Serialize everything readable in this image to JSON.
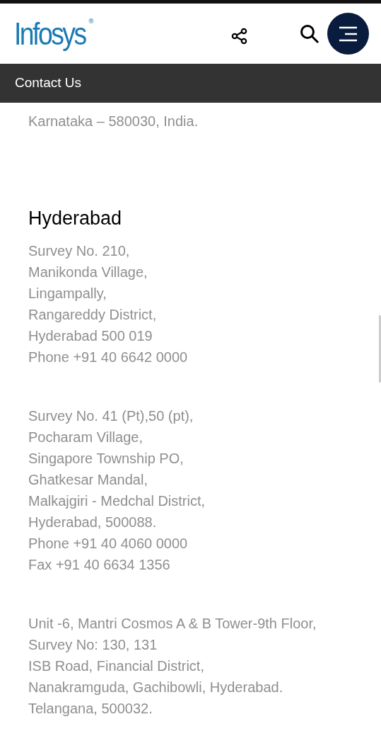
{
  "header": {
    "logo": "Infosys",
    "logo_mark": "®"
  },
  "page_bar": {
    "title": "Contact Us"
  },
  "sections": [
    {
      "addresses": [
        {
          "lines": [
            "Karnataka – 580030, India."
          ]
        }
      ]
    },
    {
      "heading": "Hyderabad",
      "addresses": [
        {
          "lines": [
            "Survey No. 210,",
            "Manikonda Village,",
            "Lingampally,",
            "Rangareddy District,",
            "Hyderabad 500 019",
            "Phone +91 40 6642 0000"
          ]
        },
        {
          "lines": [
            "Survey No. 41 (Pt),50 (pt),",
            "Pocharam Village,",
            "Singapore Township PO,",
            "Ghatkesar Mandal,",
            "Malkajgiri - Medchal District,",
            "Hyderabad, 500088.",
            "Phone +91 40 4060 0000",
            "Fax +91 40 6634 1356"
          ]
        },
        {
          "lines": [
            "Unit -6, Mantri Cosmos A & B Tower-9th Floor,",
            "Survey No: 130, 131",
            "ISB Road, Financial District,",
            "Nanakramguda, Gachibowli, Hyderabad.",
            "Telangana, 500032."
          ]
        }
      ]
    }
  ]
}
